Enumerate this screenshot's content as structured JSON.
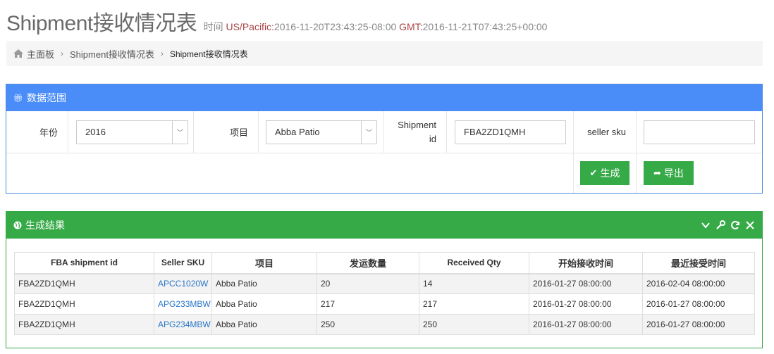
{
  "header": {
    "title": "Shipment接收情况表",
    "time_label": "时间",
    "tz1": "US/Pacific:",
    "time1": "2016-11-20T23:43:25-08:00",
    "tz2": "GMT:",
    "time2": "2016-11-21T07:43:25+00:00"
  },
  "breadcrumb": {
    "icon": "home-icon",
    "items": [
      "主面板",
      "Shipment接收情况表",
      "Shipment接收情况表"
    ]
  },
  "filter_panel": {
    "title": "数据范围",
    "icon": "gift-icon",
    "color": "#4b8df8",
    "year_label": "年份",
    "year_value": "2016",
    "project_label": "项目",
    "project_value": "Abba Patio",
    "shipment_label_1": "Shipment",
    "shipment_label_2": "id",
    "shipment_value": "FBA2ZD1QMH",
    "seller_sku_label": "seller sku",
    "seller_sku_value": "",
    "generate_button": "生成",
    "export_button": "导出"
  },
  "result_panel": {
    "title": "生成结果",
    "icon": "globe-icon",
    "color": "#35aa47",
    "tools": [
      "chevron-down-icon",
      "wrench-icon",
      "refresh-icon",
      "close-icon"
    ],
    "columns": [
      "FBA shipment id",
      "Seller SKU",
      "项目",
      "发运数量",
      "Received Qty",
      "开始接收时间",
      "最近接受时间"
    ],
    "rows": [
      [
        "FBA2ZD1QMH",
        "APCC1020W",
        "Abba Patio",
        "20",
        "14",
        "2016-01-27 08:00:00",
        "2016-02-04 08:00:00"
      ],
      [
        "FBA2ZD1QMH",
        "APG233MBW",
        "Abba Patio",
        "217",
        "217",
        "2016-01-27 08:00:00",
        "2016-01-27 08:00:00"
      ],
      [
        "FBA2ZD1QMH",
        "APG234MBW",
        "Abba Patio",
        "250",
        "250",
        "2016-01-27 08:00:00",
        "2016-01-27 08:00:00"
      ]
    ]
  }
}
